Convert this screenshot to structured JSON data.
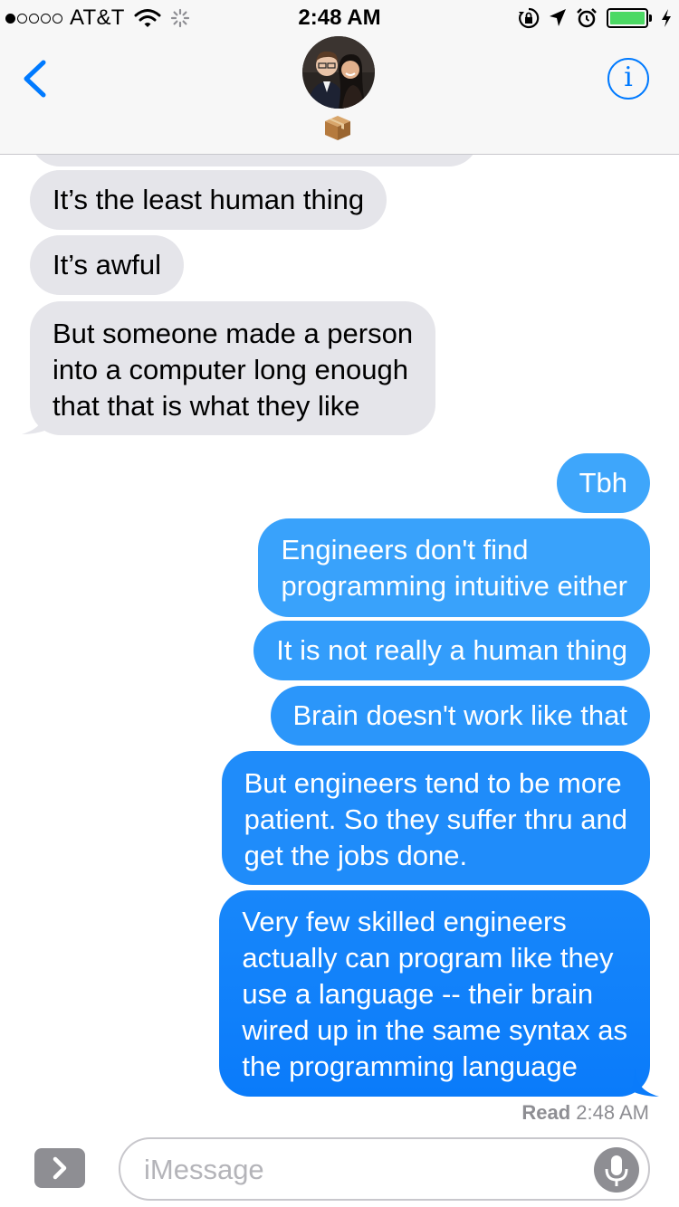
{
  "status_bar": {
    "carrier": "AT&T",
    "time": "2:48 AM",
    "battery_level": 1.0,
    "icons": [
      "signal-icon",
      "wifi-icon",
      "activity-spinner-icon",
      "orientation-lock-icon",
      "location-icon",
      "alarm-icon",
      "battery-icon",
      "charging-icon"
    ]
  },
  "header": {
    "back_icon": "chevron-left-icon",
    "contact_avatar": "contact-photo",
    "contact_emoji": "package-emoji",
    "info_icon": "info-icon",
    "info_glyph": "i"
  },
  "messages": [
    {
      "direction": "incoming",
      "text": ""
    },
    {
      "direction": "incoming",
      "text": "It’s the least human thing"
    },
    {
      "direction": "incoming",
      "text": "It’s awful"
    },
    {
      "direction": "incoming",
      "lines": [
        "But someone made a person",
        "into a computer long enough",
        "that that is what they like"
      ]
    },
    {
      "direction": "outgoing",
      "text": "Tbh"
    },
    {
      "direction": "outgoing",
      "lines": [
        "Engineers don't find",
        "programming intuitive either"
      ]
    },
    {
      "direction": "outgoing",
      "text": "It is not really a human thing"
    },
    {
      "direction": "outgoing",
      "text": "Brain doesn't work like that"
    },
    {
      "direction": "outgoing",
      "lines": [
        "But engineers tend to be more",
        "patient. So they suffer thru and",
        "get the jobs done."
      ]
    },
    {
      "direction": "outgoing",
      "lines": [
        "Very few skilled engineers",
        "actually can program like they",
        "use a language -- their brain",
        "wired up in the same syntax as",
        "the programming language"
      ]
    }
  ],
  "read_receipt": {
    "label": "Read",
    "time": "2:48 AM"
  },
  "composer": {
    "app_drawer_icon": "chevron-right-icon",
    "placeholder": "iMessage",
    "value": "",
    "mic_icon": "microphone-icon"
  },
  "colors": {
    "accent": "#007aff",
    "incoming_bubble": "#e5e5ea",
    "outgoing_top": "#41a8fb",
    "outgoing_bottom": "#0a7bfa",
    "battery": "#4cd964",
    "muted": "#8e8e93"
  }
}
